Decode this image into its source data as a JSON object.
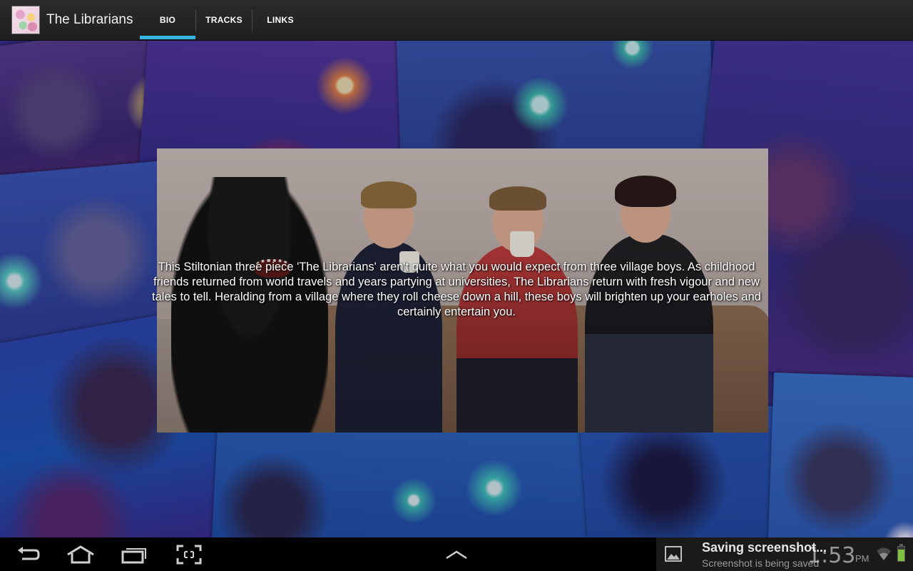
{
  "app": {
    "title": "The Librarians",
    "icon": "app-logo-icon"
  },
  "tabs": [
    {
      "label": "BIO",
      "selected": true
    },
    {
      "label": "TRACKS",
      "selected": false
    },
    {
      "label": "LINKS",
      "selected": false
    }
  ],
  "accent_color": "#33b5e5",
  "bio": {
    "text": "This Stiltonian three piece 'The Librarians' aren't quite what you would expect from three village boys. As childhood friends returned from world travels and years partying at universities, The Librarians return with fresh vigour and new tales to tell. Heralding from a village where they roll cheese down a hill, these boys will brighten up your earholes and certainly entertain you."
  },
  "system_bar": {
    "buttons": [
      "back-icon",
      "home-icon",
      "recent-apps-icon",
      "screenshot-icon",
      "menu-up-icon"
    ],
    "notification": {
      "title": "Saving screenshot...",
      "subtitle": "Screenshot is being saved",
      "icon": "image-icon"
    },
    "clock": "1:53",
    "ampm": "PM",
    "status_icons": [
      "wifi-icon",
      "battery-icon"
    ],
    "battery_color": "#7fc242"
  }
}
